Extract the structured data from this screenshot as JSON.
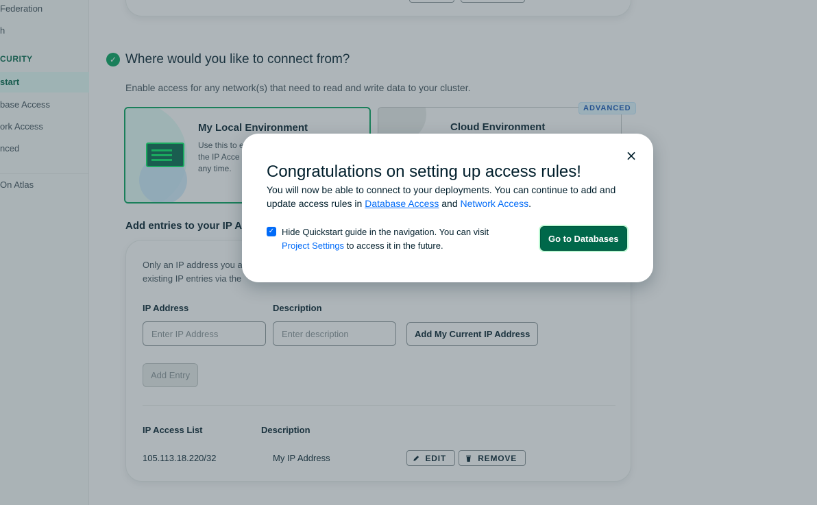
{
  "sidebar": {
    "items": [
      {
        "label": "Federation",
        "type": "item"
      },
      {
        "label": "h",
        "type": "item"
      },
      {
        "label": "CURITY",
        "type": "heading"
      },
      {
        "label": "start",
        "type": "active"
      },
      {
        "label": "base Access",
        "type": "item"
      },
      {
        "label": "ork Access",
        "type": "item"
      },
      {
        "label": "nced",
        "type": "item"
      },
      {
        "label": "On Atlas",
        "type": "item"
      }
    ]
  },
  "connect_section": {
    "title": "Where would you like to connect from?",
    "subtitle": "Enable access for any network(s) that need to read and write data to your cluster.",
    "local_env": {
      "title": "My Local Environment",
      "description": "Use this to e the IP Acce any time."
    },
    "cloud_env": {
      "title": "Cloud Environment",
      "badge": "ADVANCED"
    }
  },
  "entries_section": {
    "title": "Add entries to your IP Ac",
    "intro": "Only an IP address you a existing IP entries via the",
    "ip_label": "IP Address",
    "ip_placeholder": "Enter IP Address",
    "desc_label": "Description",
    "desc_placeholder": "Enter description",
    "add_current_ip": "Add My Current IP Address",
    "add_entry": "Add Entry",
    "list_header_ip": "IP Access List",
    "list_header_desc": "Description",
    "rows": [
      {
        "ip": "105.113.18.220/32",
        "description": "My IP Address"
      }
    ],
    "edit_label": "EDIT",
    "remove_label": "REMOVE"
  },
  "modal": {
    "close_icon": "×",
    "title": "Congratulations on setting up access rules!",
    "body_prefix": "You will now be able to connect to your deployments. You can continue to add and update access rules in",
    "link_database_access": "Database Access",
    "body_and": "and",
    "link_network_access": "Network Access",
    "body_suffix": ".",
    "checkbox_checked": true,
    "checkbox_text_prefix": "Hide Quickstart guide in the navigation. You can visit",
    "link_project_settings": "Project Settings",
    "checkbox_text_suffix": "to access it in the future.",
    "primary_button": "Go to Databases"
  },
  "colors": {
    "brand_green": "#00684a",
    "success_green": "#00a35c",
    "link_blue": "#016bf8",
    "overlay": "rgba(61,79,88,0.42)"
  }
}
